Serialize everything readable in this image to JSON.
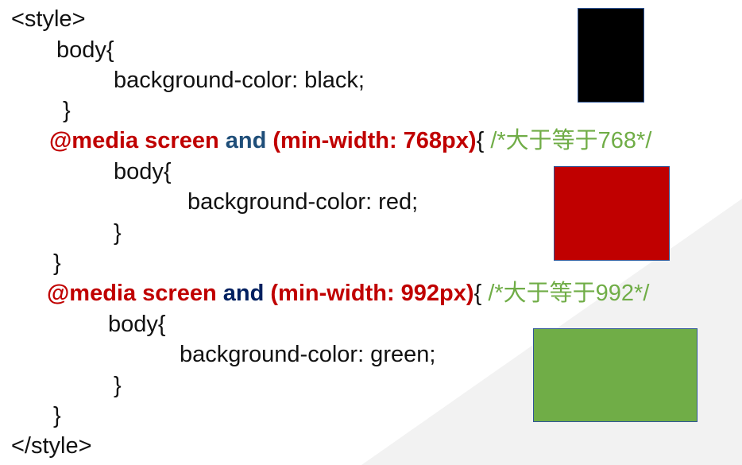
{
  "code": {
    "open_style": "<style>",
    "body1_sel": "body{",
    "body1_decl": "background-color: black;",
    "body1_close": "}",
    "media1": {
      "at": "@media screen",
      "and": "and",
      "open_paren": "(",
      "cond": "min-width: 768px",
      "close_paren": ")",
      "brace": "{",
      "comment": "/*大于等于768*/"
    },
    "body2_sel": "body{",
    "body2_decl": "background-color: red;",
    "body2_inner_close": "}",
    "media1_close": "}",
    "media2": {
      "at": "@media screen",
      "and": "and",
      "open_paren": "(",
      "cond": "min-width: 992px",
      "close_paren": ")",
      "brace": "{",
      "comment": "/*大于等于992*/"
    },
    "body3_sel": "body{",
    "body3_decl": "background-color: green;",
    "body3_inner_close": "}",
    "media2_close": "}",
    "close_style": "</style>"
  },
  "swatches": {
    "black": "#000000",
    "red": "#c00000",
    "green": "#70ad47",
    "border": "#2f5597"
  }
}
